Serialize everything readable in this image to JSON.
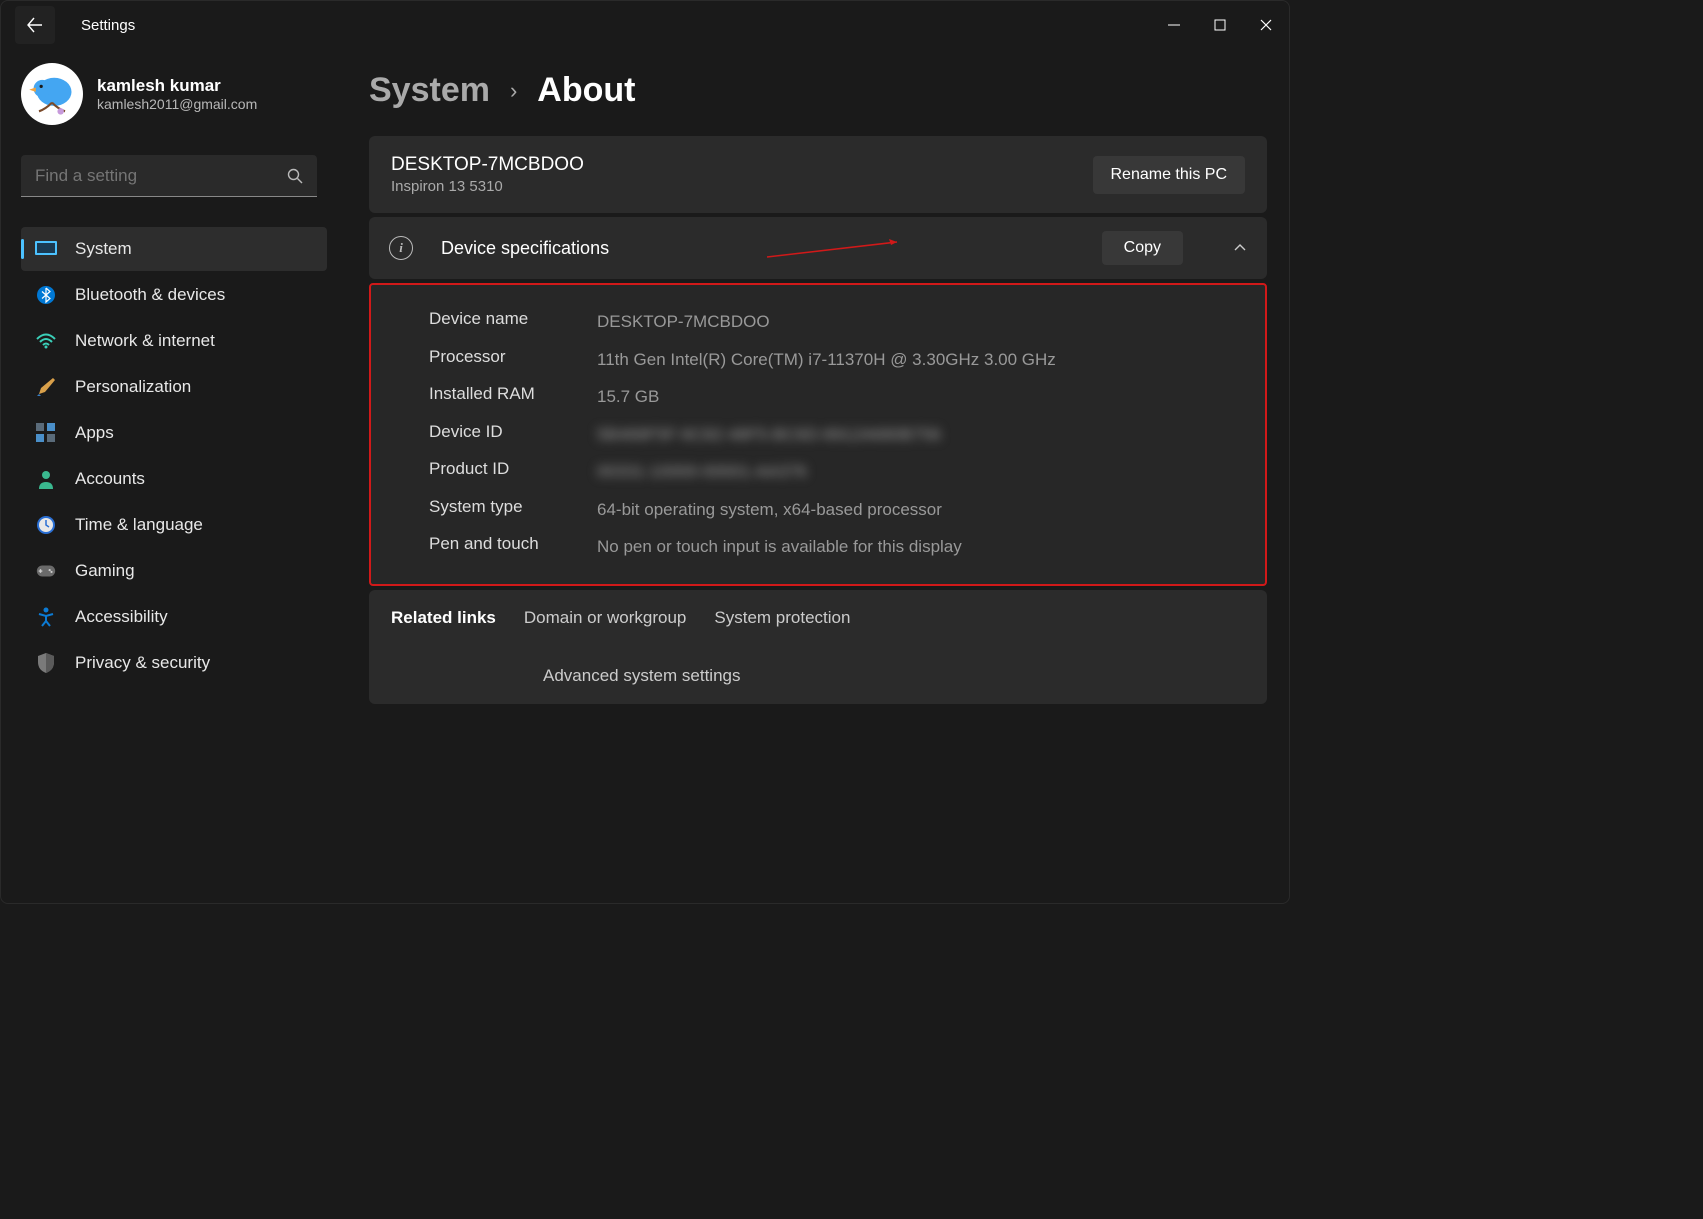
{
  "window": {
    "app_title": "Settings"
  },
  "user": {
    "name": "kamlesh kumar",
    "email": "kamlesh2011@gmail.com"
  },
  "search": {
    "placeholder": "Find a setting"
  },
  "nav": {
    "items": [
      {
        "label": "System",
        "icon": "system",
        "active": true
      },
      {
        "label": "Bluetooth & devices",
        "icon": "bluetooth"
      },
      {
        "label": "Network & internet",
        "icon": "wifi"
      },
      {
        "label": "Personalization",
        "icon": "brush"
      },
      {
        "label": "Apps",
        "icon": "apps"
      },
      {
        "label": "Accounts",
        "icon": "account"
      },
      {
        "label": "Time & language",
        "icon": "clock"
      },
      {
        "label": "Gaming",
        "icon": "gaming"
      },
      {
        "label": "Accessibility",
        "icon": "accessibility"
      },
      {
        "label": "Privacy & security",
        "icon": "shield"
      }
    ]
  },
  "breadcrumb": {
    "parent": "System",
    "current": "About"
  },
  "pc": {
    "name": "DESKTOP-7MCBDOO",
    "model": "Inspiron 13 5310",
    "rename_label": "Rename this PC"
  },
  "specs": {
    "title": "Device specifications",
    "copy_label": "Copy",
    "rows": [
      {
        "label": "Device name",
        "value": "DESKTOP-7MCBDOO"
      },
      {
        "label": "Processor",
        "value": "11th Gen Intel(R) Core(TM) i7-11370H @ 3.30GHz   3.00 GHz"
      },
      {
        "label": "Installed RAM",
        "value": "15.7 GB"
      },
      {
        "label": "Device ID",
        "value": "5B468F5F-6C82-48F5-BC6D-8912A680B756",
        "blurred": true
      },
      {
        "label": "Product ID",
        "value": "00331-10000-00001-AA376",
        "blurred": true
      },
      {
        "label": "System type",
        "value": "64-bit operating system, x64-based processor"
      },
      {
        "label": "Pen and touch",
        "value": "No pen or touch input is available for this display"
      }
    ]
  },
  "related": {
    "title": "Related links",
    "links": [
      "Domain or workgroup",
      "System protection",
      "Advanced system settings"
    ]
  }
}
